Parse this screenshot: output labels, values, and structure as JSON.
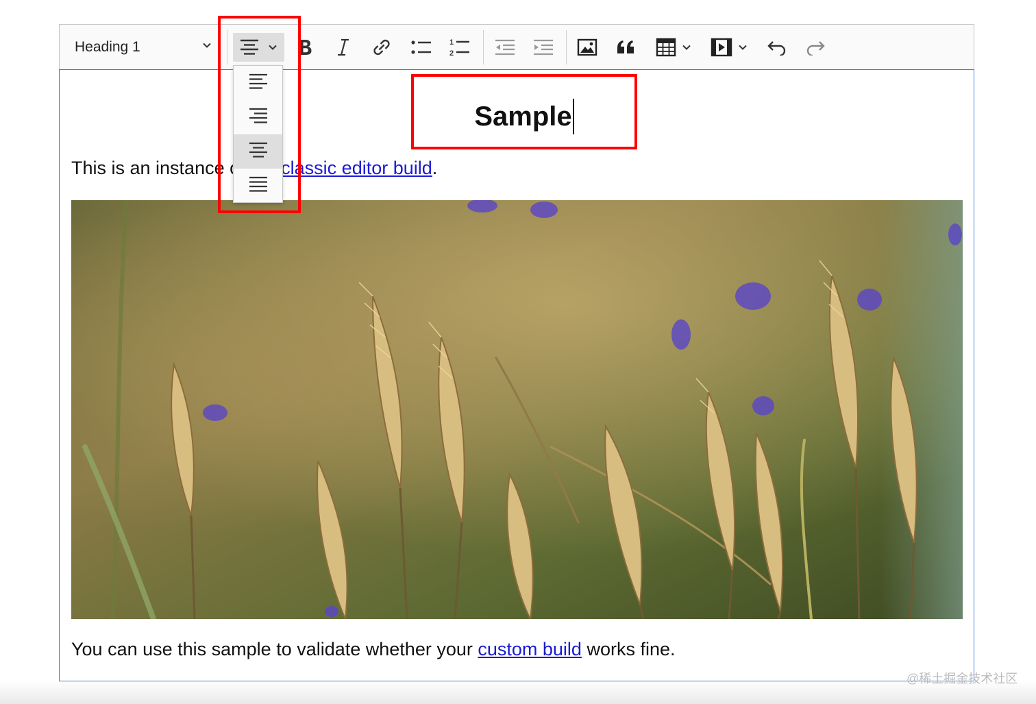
{
  "toolbar": {
    "heading_select": "Heading 1",
    "buttons": {
      "alignment": "alignment",
      "bold": "bold",
      "italic": "italic",
      "link": "link",
      "bulleted_list": "bulleted list",
      "numbered_list": "numbered list",
      "outdent": "outdent",
      "indent": "indent",
      "image": "insert image",
      "quote": "block quote",
      "table": "insert table",
      "media": "insert media",
      "undo": "undo",
      "redo": "redo"
    }
  },
  "alignment_dropdown": {
    "options": [
      "align left",
      "align right",
      "align center",
      "justify"
    ],
    "selected": "align center"
  },
  "content": {
    "heading": "Sample",
    "paragraph1": {
      "before": "This is an instance of the ",
      "link": "classic editor build",
      "after": "."
    },
    "image_alt": "wheat field",
    "paragraph2": {
      "before": "You can use this sample to validate whether your ",
      "link": "custom build",
      "after": " works fine."
    }
  },
  "watermark": "@稀土掘金技术社区",
  "colors": {
    "highlight_box": "#ff0000",
    "link": "#1a1ad6",
    "focus_border": "#3d7fd6",
    "toolbar_bg": "#fafafa"
  }
}
